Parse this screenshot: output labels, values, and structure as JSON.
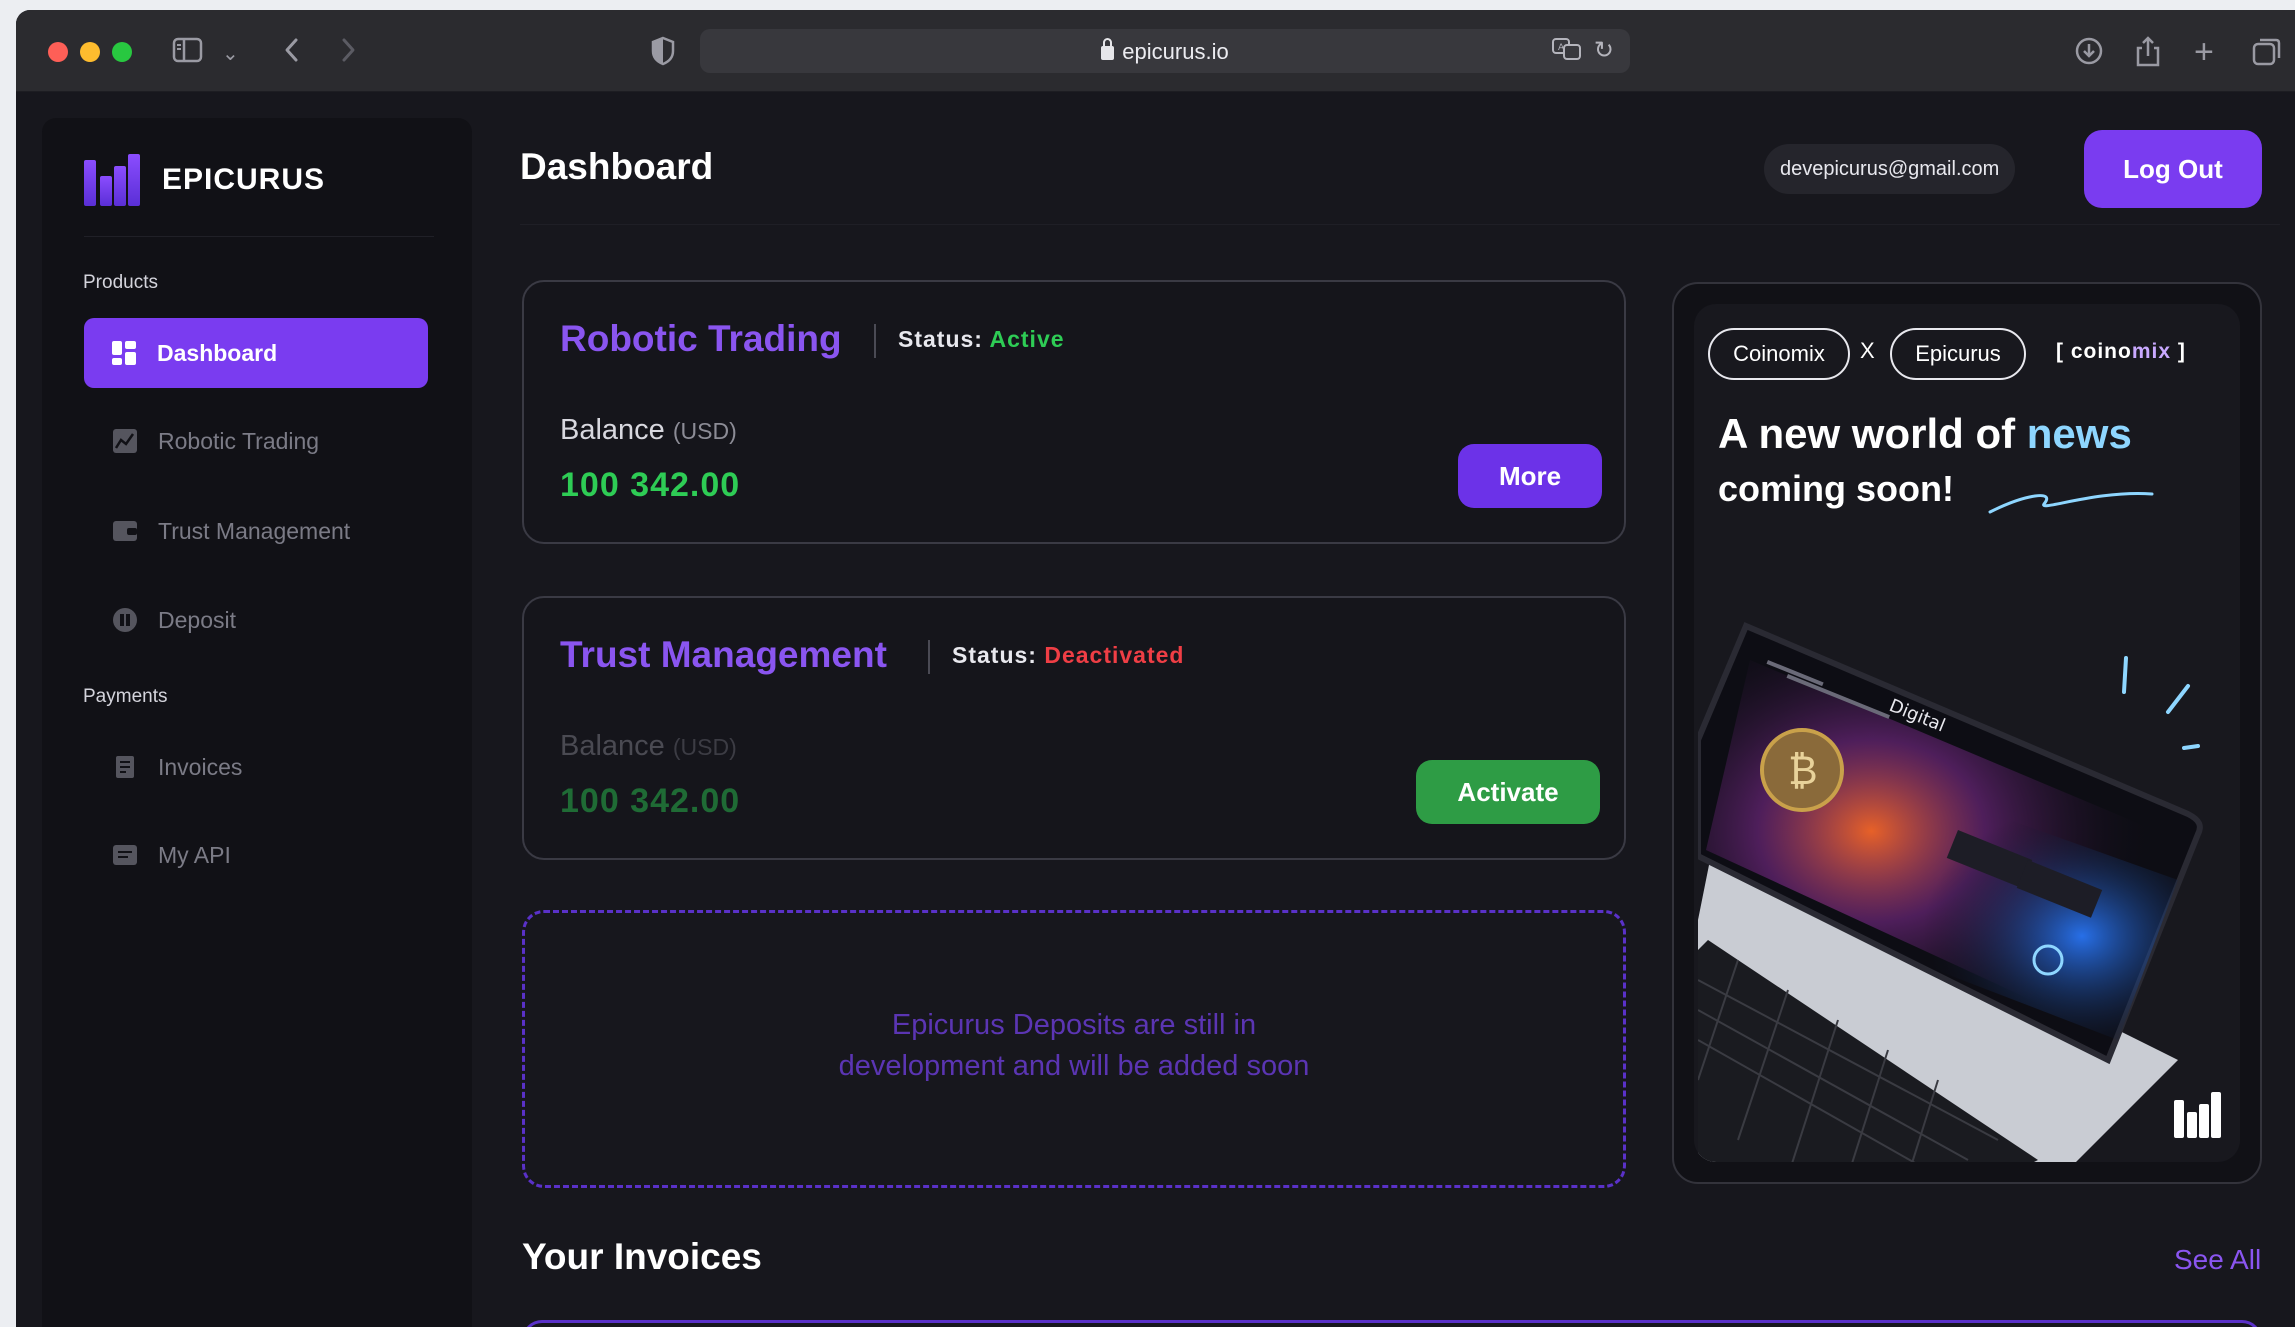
{
  "browser": {
    "url": "epicurus.io"
  },
  "sidebar": {
    "logo_text": "EPICURUS",
    "sections": {
      "products_label": "Products",
      "payments_label": "Payments"
    },
    "items": [
      {
        "label": "Dashboard",
        "icon": "grid-icon",
        "active": true
      },
      {
        "label": "Robotic Trading",
        "icon": "chart-icon",
        "active": false
      },
      {
        "label": "Trust Management",
        "icon": "wallet-icon",
        "active": false
      },
      {
        "label": "Deposit",
        "icon": "pause-circle-icon",
        "active": false
      },
      {
        "label": "Invoices",
        "icon": "receipt-icon",
        "active": false
      },
      {
        "label": "My API",
        "icon": "api-icon",
        "active": false
      }
    ]
  },
  "header": {
    "title": "Dashboard",
    "email": "devepicurus@gmail.com",
    "logout_label": "Log Out"
  },
  "cards": [
    {
      "title": "Robotic Trading",
      "status_label": "Status:",
      "status_value": "Active",
      "balance_label": "Balance",
      "balance_unit": "(USD)",
      "balance_value": "100 342.00",
      "button_label": "More"
    },
    {
      "title": "Trust Management",
      "status_label": "Status:",
      "status_value": "Deactivated",
      "balance_label": "Balance",
      "balance_unit": "(USD)",
      "balance_value": "100 342.00",
      "button_label": "Activate"
    }
  ],
  "deposits_notice": {
    "line1": "Epicurus Deposits are still in",
    "line2": "development and will be added soon"
  },
  "invoices": {
    "title": "Your Invoices",
    "see_all_label": "See All"
  },
  "promo": {
    "pill_left": "Coinomix",
    "x": "X",
    "pill_right": "Epicurus",
    "brand_prefix": "[ coino",
    "brand_mix": "mix",
    "brand_suffix": " ]",
    "headline_prefix": "A new world of ",
    "headline_highlight": "news",
    "headline_line2": "coming soon!",
    "screen_heading": "Digital"
  },
  "colors": {
    "accent": "#7a3cf0",
    "active": "#2ecc55",
    "deactivated": "#ef3e45",
    "activate_button": "#2e9c45"
  }
}
